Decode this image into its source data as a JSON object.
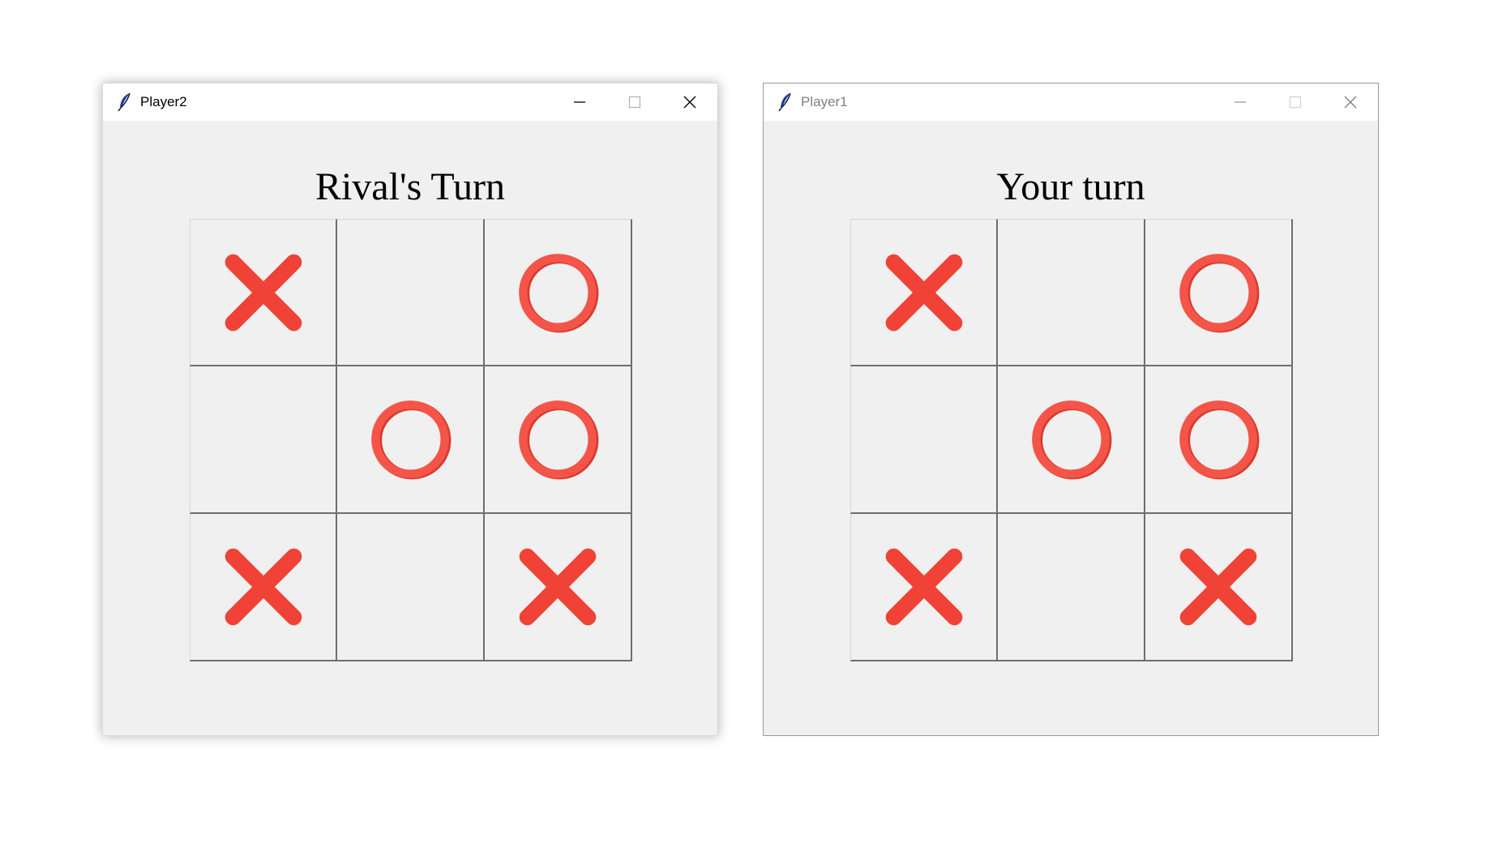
{
  "colors": {
    "mark_x": "#f04236",
    "mark_o": "#f45548",
    "mark_o_shade": "#d93a2e",
    "window_bg": "#f0f0f0",
    "grid_line": "#6e6e6e"
  },
  "windows": [
    {
      "title": "Player2",
      "state": "active",
      "status": "Rival's Turn",
      "board": [
        "X",
        "",
        "O",
        "",
        "O",
        "O",
        "X",
        "",
        "X"
      ]
    },
    {
      "title": "Player1",
      "state": "inactive",
      "status": "Your turn",
      "board": [
        "X",
        "",
        "O",
        "",
        "O",
        "O",
        "X",
        "",
        "X"
      ]
    }
  ],
  "icons": {
    "app": "feather-icon",
    "minimize": "minimize-icon",
    "maximize": "maximize-icon",
    "close": "close-icon"
  }
}
